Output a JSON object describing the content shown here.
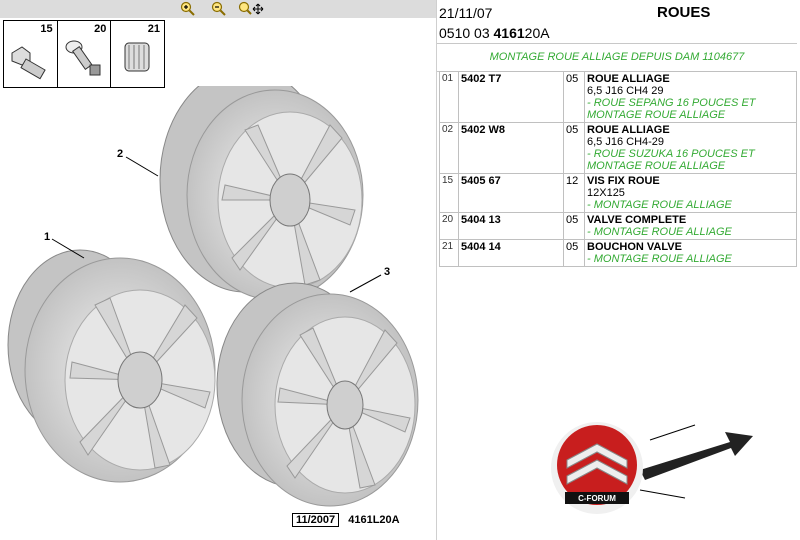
{
  "toolbar": {
    "zoom_in": "zoom-in",
    "zoom_out": "zoom-out",
    "zoom_move": "zoom-move"
  },
  "thumbs": [
    {
      "num": "15"
    },
    {
      "num": "20"
    },
    {
      "num": "21"
    }
  ],
  "callouts": [
    {
      "num": "2"
    },
    {
      "num": "1"
    },
    {
      "num": "3"
    }
  ],
  "footer": {
    "date": "11/2007",
    "code": "4161L20A"
  },
  "header": {
    "date": "21/11/07",
    "title": "ROUES",
    "code_prefix": "0510 03",
    "code_bold": "4161",
    "code_suffix": "20A"
  },
  "section": "MONTAGE ROUE ALLIAGE DEPUIS DAM 1104677",
  "parts": [
    {
      "idx": "01",
      "ref": "5402 T7",
      "qty": "05",
      "name": "ROUE ALLIAGE",
      "spec": "6,5 J16 CH4 29",
      "notes": [
        "- ROUE SEPANG 16 POUCES ET",
        "MONTAGE ROUE ALLIAGE"
      ]
    },
    {
      "idx": "02",
      "ref": "5402 W8",
      "qty": "05",
      "name": "ROUE ALLIAGE",
      "spec": "6,5 J16 CH4-29",
      "notes": [
        "- ROUE SUZUKA 16 POUCES ET",
        "MONTAGE ROUE ALLIAGE"
      ]
    },
    {
      "idx": "15",
      "ref": "5405 67",
      "qty": "12",
      "name": "VIS FIX ROUE",
      "spec": "12X125",
      "notes": [
        "- MONTAGE ROUE ALLIAGE"
      ]
    },
    {
      "idx": "20",
      "ref": "5404 13",
      "qty": "05",
      "name": "VALVE COMPLETE",
      "spec": "",
      "notes": [
        "- MONTAGE ROUE ALLIAGE"
      ]
    },
    {
      "idx": "21",
      "ref": "5404 14",
      "qty": "05",
      "name": "BOUCHON VALVE",
      "spec": "",
      "notes": [
        "- MONTAGE ROUE ALLIAGE"
      ]
    }
  ],
  "logo": {
    "text": "C-FORUM"
  },
  "colors": {
    "accent_green": "#33aa33",
    "logo_red": "#c81e1e"
  }
}
